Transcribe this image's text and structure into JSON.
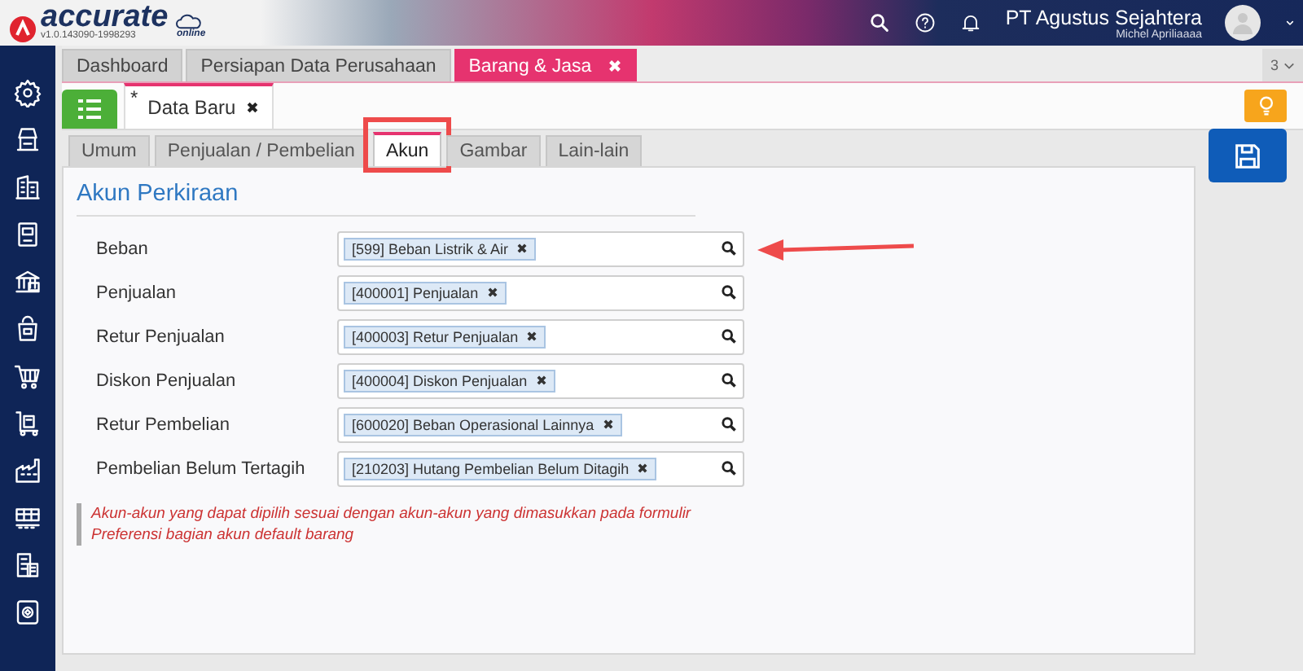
{
  "header": {
    "brand": "accurate",
    "edition": "online",
    "version": "v1.0.143090-1998293",
    "company": "PT Agustus Sejahtera",
    "user": "Michel Apriliaaaa"
  },
  "doc_tabs": [
    {
      "label": "Dashboard",
      "selected": false,
      "closable": false
    },
    {
      "label": "Persiapan Data Perusahaan",
      "selected": false,
      "closable": false
    },
    {
      "label": "Barang & Jasa",
      "selected": true,
      "closable": true
    }
  ],
  "tab_overflow": "3",
  "form_tab": {
    "marker": "*",
    "label": "Data Baru"
  },
  "form_tabs": [
    {
      "label": "Umum",
      "selected": false,
      "highlighted": false
    },
    {
      "label": "Penjualan / Pembelian",
      "selected": false,
      "highlighted": false
    },
    {
      "label": "Akun",
      "selected": true,
      "highlighted": true
    },
    {
      "label": "Gambar",
      "selected": false,
      "highlighted": false
    },
    {
      "label": "Lain-lain",
      "selected": false,
      "highlighted": false
    }
  ],
  "section_title": "Akun Perkiraan",
  "fields": [
    {
      "label": "Beban",
      "value": "[599] Beban Listrik & Air",
      "pointed": true
    },
    {
      "label": "Penjualan",
      "value": "[400001] Penjualan",
      "pointed": false
    },
    {
      "label": "Retur Penjualan",
      "value": "[400003] Retur Penjualan",
      "pointed": false
    },
    {
      "label": "Diskon Penjualan",
      "value": "[400004] Diskon Penjualan",
      "pointed": false
    },
    {
      "label": "Retur Pembelian",
      "value": "[600020] Beban Operasional Lainnya",
      "pointed": false
    },
    {
      "label": "Pembelian Belum Tertagih",
      "value": "[210203] Hutang Pembelian Belum Ditagih",
      "pointed": false
    }
  ],
  "note": "Akun-akun yang dapat dipilih sesuai dengan akun-akun yang dimasukkan pada formulir Preferensi bagian akun default barang"
}
